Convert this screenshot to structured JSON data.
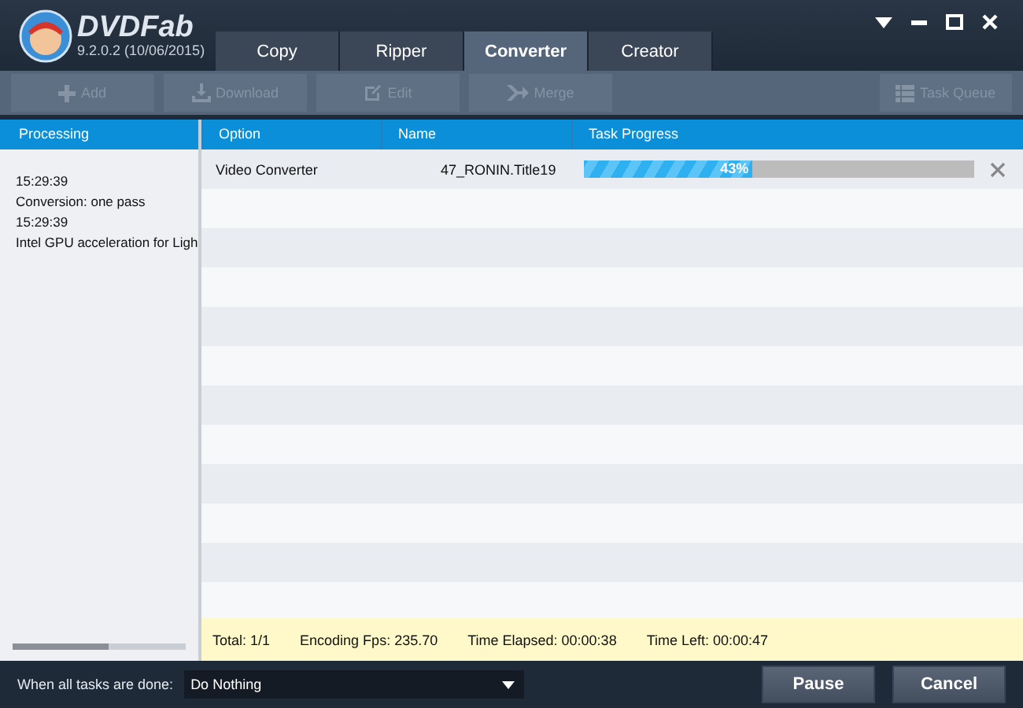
{
  "app": {
    "name": "DVDFab",
    "version": "9.2.0.2 (10/06/2015)"
  },
  "tabs": [
    {
      "label": "Copy",
      "selected": false
    },
    {
      "label": "Ripper",
      "selected": false
    },
    {
      "label": "Converter",
      "selected": true
    },
    {
      "label": "Creator",
      "selected": false
    }
  ],
  "toolbar": [
    {
      "label": "Add",
      "disabled": true
    },
    {
      "label": "Download",
      "disabled": true
    },
    {
      "label": "Edit",
      "disabled": true
    },
    {
      "label": "Merge",
      "disabled": true
    }
  ],
  "task_queue": {
    "label": "Task Queue",
    "disabled": true
  },
  "processing": {
    "header": "Processing",
    "lines": [
      "15:29:39",
      "Conversion: one pass",
      "15:29:39",
      "Intel GPU acceleration for Ligh"
    ]
  },
  "table": {
    "columns": [
      "Option",
      "Name",
      "Task Progress"
    ],
    "rows": [
      {
        "option": "Video Converter",
        "name": "47_RONIN.Title19",
        "level": 0.43,
        "percent": "43%"
      }
    ]
  },
  "status": [
    "Total: 1/1",
    "Encoding Fps: 235.70",
    "Time Elapsed: 00:00:38",
    "Time Left: 00:00:47"
  ],
  "footer": {
    "label": "When all tasks are done:",
    "value": "Do Nothing",
    "buttons": [
      "Pause",
      "Cancel"
    ]
  }
}
